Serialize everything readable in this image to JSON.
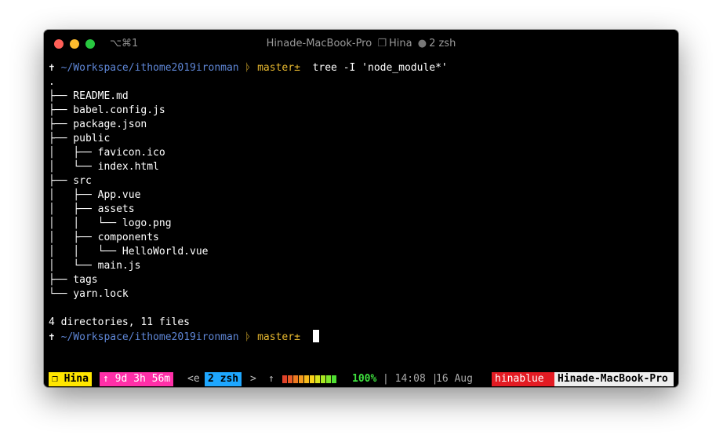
{
  "window": {
    "shortcut": "⌥⌘1",
    "title_host": "Hinade-MacBook-Pro",
    "title_session": "Hina",
    "title_window": "2 zsh"
  },
  "prompt": {
    "arrow": "✝",
    "path": "~/Workspace/ithome2019ironman",
    "branch_icon": "ᚦ",
    "branch": "master±",
    "command": "tree -I 'node_module*'"
  },
  "tree_output": [
    ".",
    "├── README.md",
    "├── babel.config.js",
    "├── package.json",
    "├── public",
    "│   ├── favicon.ico",
    "│   └── index.html",
    "├── src",
    "│   ├── App.vue",
    "│   ├── assets",
    "│   │   └── logo.png",
    "│   ├── components",
    "│   │   └── HelloWorld.vue",
    "│   └── main.js",
    "├── tags",
    "└── yarn.lock",
    "",
    "4 directories, 11 files"
  ],
  "status_bar": {
    "session": "❐ Hina",
    "uptime": "↑ 9d 3h 56m",
    "prev": "<e",
    "window": "2 zsh",
    "next": ">",
    "up_arrow": "↑",
    "battery_colors": [
      "#e0422a",
      "#e85a26",
      "#ee7a22",
      "#f29a1f",
      "#f6ba1c",
      "#f7d21a",
      "#d8e41d",
      "#a8e823",
      "#7ee72b",
      "#4fe033"
    ],
    "battery": "100%",
    "time": "| 14:08 |",
    "date": "16 Aug",
    "user": "hinablue",
    "host": "Hinade-MacBook-Pro"
  }
}
